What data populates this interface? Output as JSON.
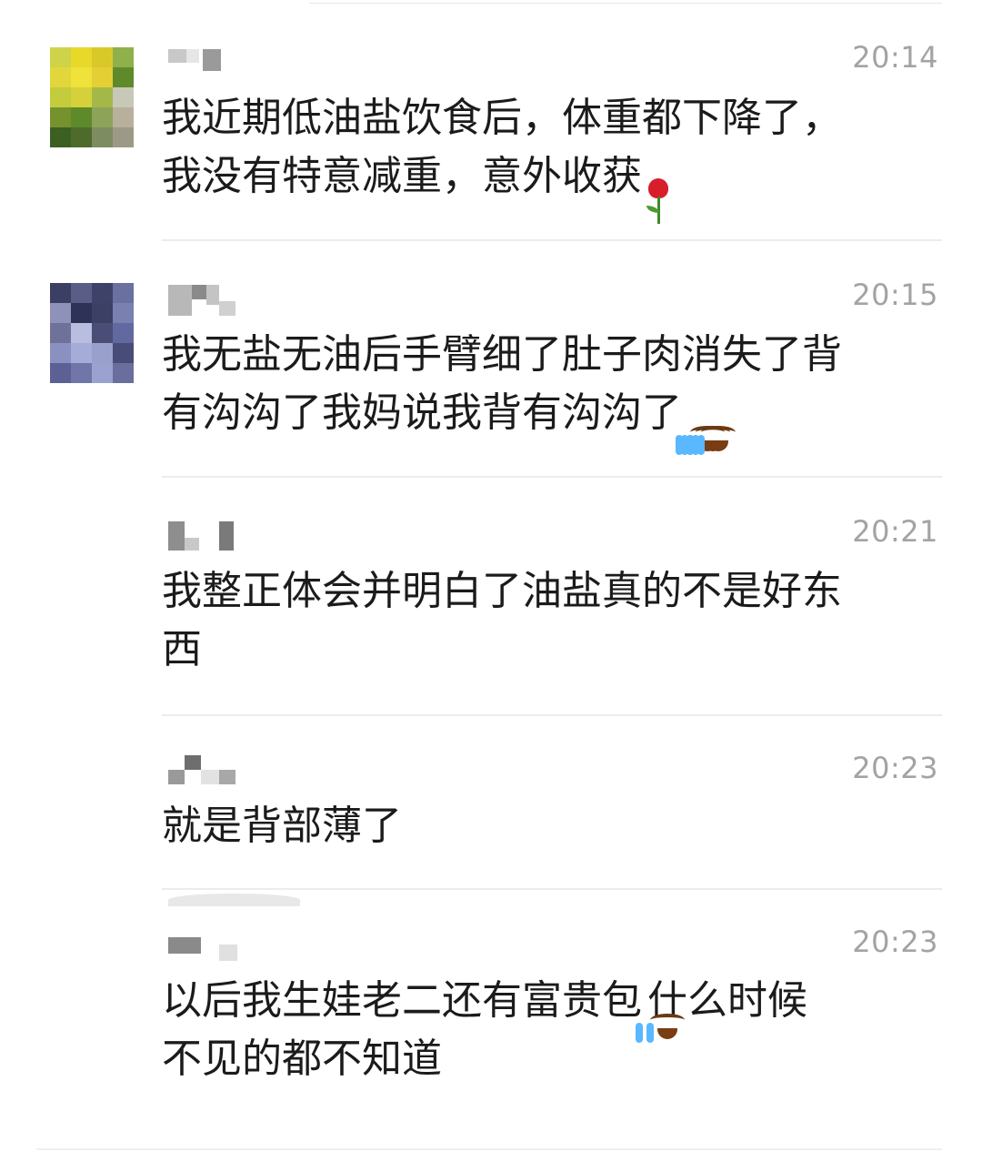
{
  "comments": [
    {
      "time": "20:14",
      "line1": "我近期低油盐饮食后，体重都下降了，",
      "line2": "我没有特意减重，意外收获",
      "emoji": [
        "rose-icon"
      ]
    },
    {
      "time": "20:15",
      "line1": "我无盐无油后手臂细了肚子肉消失了背",
      "line2": "有沟沟了我妈说我背有沟沟了",
      "emoji": [
        "face-with-tears-icon",
        "face-with-tears-icon",
        "face-with-tears-icon"
      ]
    },
    {
      "time": "20:21",
      "line1": "我整正体会并明白了油盐真的不是好东",
      "line2": "西"
    },
    {
      "time": "20:23",
      "line1": "就是背部薄了"
    },
    {
      "time": "20:23",
      "line1a": "以后我生娃老二还有富贵包",
      "line1b": "什么时候",
      "line2": "不见的都不知道",
      "emoji": [
        "face-with-tears-icon"
      ]
    }
  ],
  "colors": {
    "text": "#1b1b1b",
    "time": "#a3a3a3",
    "divider": "#ececec",
    "emoji_face": "#ffc53d",
    "rose": "#d81e2b"
  }
}
